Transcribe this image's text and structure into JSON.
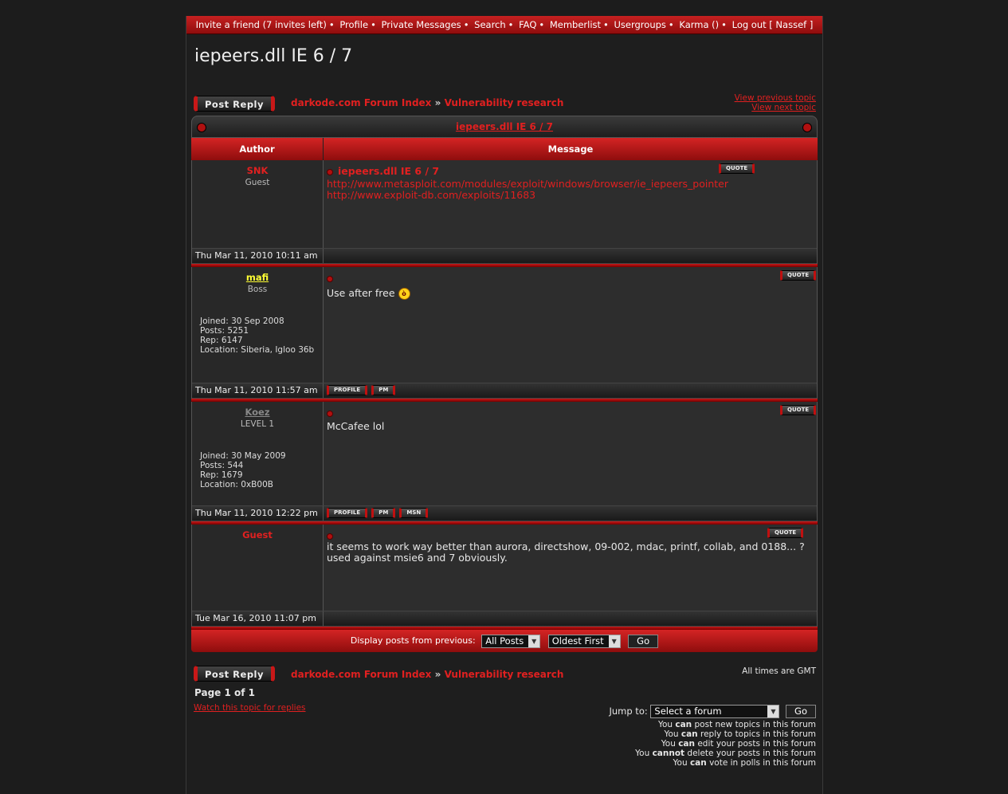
{
  "topnav": {
    "items": [
      "Invite a friend (7 invites left)",
      "Profile",
      "Private Messages",
      "Search",
      "FAQ",
      "Memberlist",
      "Usergroups",
      "Karma ()",
      "Log out [ Nassef ]"
    ],
    "separator": "•"
  },
  "page_title": "iepeers.dll IE 6 / 7",
  "post_reply_label": "Post Reply",
  "breadcrumb": {
    "index": "darkode.com Forum Index",
    "arrow": "»",
    "forum": "Vulnerability research"
  },
  "nav": {
    "prev": "View previous topic",
    "next": "View next topic"
  },
  "table_title": "iepeers.dll IE 6 / 7",
  "columns": {
    "author": "Author",
    "message": "Message"
  },
  "buttons": {
    "quote": "QUOTE",
    "profile": "PROFILE",
    "pm": "PM",
    "msn": "MSN"
  },
  "posts": [
    {
      "author": "SNK",
      "rank": "Guest",
      "subject": "iepeers.dll IE 6 / 7",
      "line1": "http://www.metasploit.com/modules/exploit/windows/browser/ie_iepeers_pointer",
      "line2": "http://www.exploit-db.com/exploits/11683",
      "date": "Thu Mar 11, 2010 10:11 am"
    },
    {
      "author": "mafi",
      "rank": "Boss",
      "joined": "Joined: 30 Sep 2008",
      "posts": "Posts: 5251",
      "rep": "Rep: 6147",
      "location": "Location: Siberia, Igloo 36b",
      "body": "Use after free",
      "date": "Thu Mar 11, 2010 11:57 am"
    },
    {
      "author": "Koez",
      "rank": "LEVEL 1",
      "joined": "Joined: 30 May 2009",
      "posts": "Posts: 544",
      "rep": "Rep: 1679",
      "location": "Location: 0xB00B",
      "body": "McCafee lol",
      "date": "Thu Mar 11, 2010 12:22 pm"
    },
    {
      "author": "Guest",
      "rank": "",
      "body1": "it seems to work way better than aurora, directshow, 09-002, mdac, printf, collab, and 0188... ?",
      "body2": "used against msie6 and 7 obviously.",
      "date": "Tue Mar 16, 2010 11:07 pm"
    }
  ],
  "display": {
    "label": "Display posts from previous:",
    "period": "All Posts",
    "order": "Oldest First",
    "go": "Go"
  },
  "footer": {
    "timezone": "All times are GMT",
    "page": "Page 1 of 1",
    "watch": "Watch this topic for replies",
    "jump_label": "Jump to:",
    "jump_select": "Select a forum",
    "jump_go": "Go",
    "perms": [
      [
        "You ",
        "can",
        " post new topics in this forum"
      ],
      [
        "You ",
        "can",
        " reply to topics in this forum"
      ],
      [
        "You ",
        "can",
        " edit your posts in this forum"
      ],
      [
        "You ",
        "cannot",
        " delete your posts in this forum"
      ],
      [
        "You ",
        "can",
        " vote in polls in this forum"
      ]
    ]
  },
  "colors": {
    "accent": "#e02020",
    "bar": "#c62020",
    "mafi": "#ffff33",
    "koez": "#888888"
  }
}
